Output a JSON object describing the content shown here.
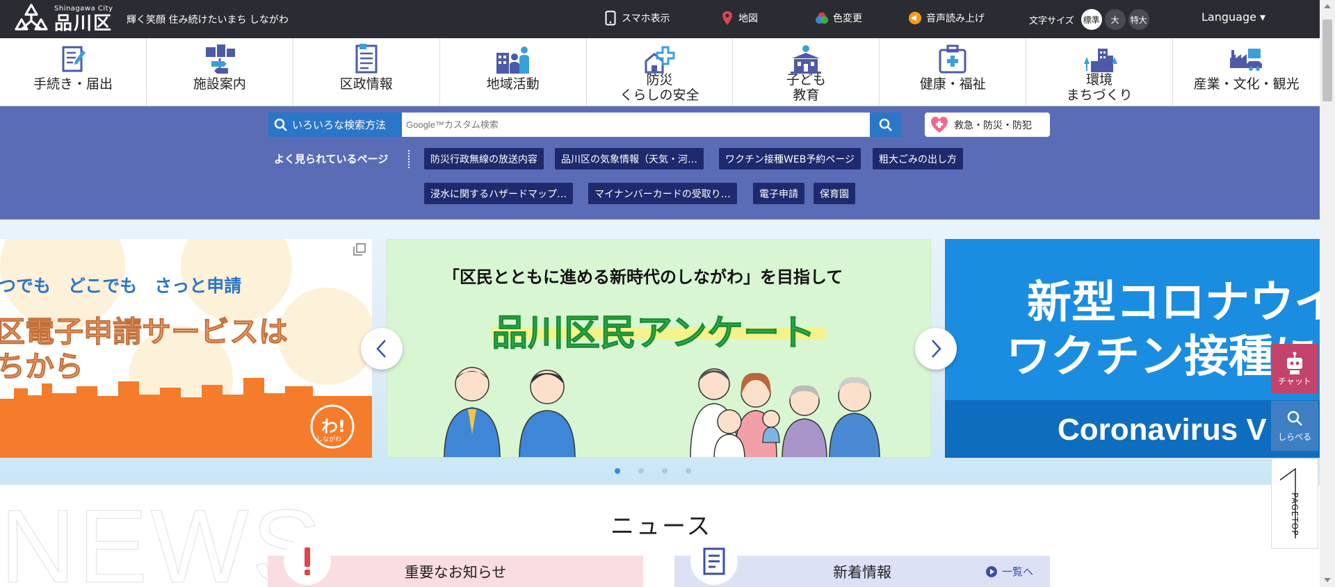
{
  "header": {
    "logo_en": "Shinagawa City",
    "logo_ja": "品川区",
    "tagline": "輝く笑顔 住み続けたいまち しながわ",
    "links": [
      {
        "label": "スマホ表示",
        "icon": "smartphone-icon"
      },
      {
        "label": "地図",
        "icon": "map-pin-icon"
      },
      {
        "label": "色変更",
        "icon": "color-change-icon"
      },
      {
        "label": "音声読み上げ",
        "icon": "speaker-icon"
      }
    ],
    "font_size_label": "文字サイズ",
    "font_sizes": [
      "標準",
      "大",
      "特大"
    ],
    "font_size_selected": "標準",
    "language": "Language ▾"
  },
  "categories": [
    {
      "label": "手続き・届出",
      "icon": "document-pen-icon"
    },
    {
      "label": "施設案内",
      "icon": "facility-signpost-icon"
    },
    {
      "label": "区政情報",
      "icon": "report-document-icon"
    },
    {
      "label": "地域活動",
      "icon": "community-icon"
    },
    {
      "label": "防災\nくらしの安全",
      "icon": "safety-house-icon"
    },
    {
      "label": "子ども\n教育",
      "icon": "school-icon"
    },
    {
      "label": "健康・福祉",
      "icon": "first-aid-icon"
    },
    {
      "label": "環境\nまちづくり",
      "icon": "city-buildings-icon"
    },
    {
      "label": "産業・文化・観光",
      "icon": "industry-icon"
    }
  ],
  "search": {
    "method_label": "いろいろな検索方法",
    "placeholder": "Google™カスタム検索",
    "emergency_label": "救急・防災・防犯",
    "popular_label": "よく見られているページ",
    "popular": [
      "防災行政無線の放送内容",
      "品川区の気象情報（天気・河…",
      "ワクチン接種WEB予約ページ",
      "粗大ごみの出し方",
      "浸水に関するハザードマップ…",
      "マイナンバーカードの受取り…",
      "電子申請",
      "保育園"
    ]
  },
  "carousel": {
    "left": {
      "line1": "つでも　どこでも　さっと申請",
      "line2": "区電子申請サービスは",
      "line3": "ちから",
      "badge": "わ!",
      "badge_sub": "しながわ"
    },
    "center": {
      "subtitle": "「区民とともに進める新時代のしながわ」を目指して",
      "title": "品川区民アンケート"
    },
    "right": {
      "line1": "新型コロナウイ",
      "line2": "ワクチン接種に",
      "line3": "Coronavirus V"
    },
    "slide_count": 4,
    "active_slide": 1
  },
  "news": {
    "watermark": "NEWS",
    "title": "ニュース",
    "tab_important": "重要なお知らせ",
    "tab_latest": "新着情報",
    "list_link": "一覧へ"
  },
  "side": {
    "chat": "チャット",
    "search": "しらべる",
    "pagetop": "PAGETOP"
  },
  "colors": {
    "topbar": "#2b2b33",
    "search_band": "#5b6cb7",
    "chip": "#1f2a6e",
    "accent_blue": "#2a76c9",
    "icon_blue": "#4d5aa8"
  }
}
